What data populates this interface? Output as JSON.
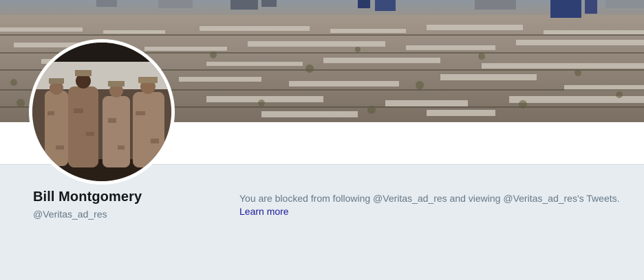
{
  "profile": {
    "name": "Bill Montgomery",
    "handle": "@Veritas_ad_res"
  },
  "blocked_notice": {
    "message": "You are blocked from following @Veritas_ad_res and viewing @Veritas_ad_res's Tweets.",
    "learn_more_label": "Learn more"
  },
  "colors": {
    "page_background": "#e6ecf0",
    "name_text": "#14171a",
    "secondary_text": "#657786",
    "link": "#1b1a9a"
  },
  "images": {
    "banner": "city-skyline-photo",
    "avatar": "soldiers-group-photo"
  }
}
